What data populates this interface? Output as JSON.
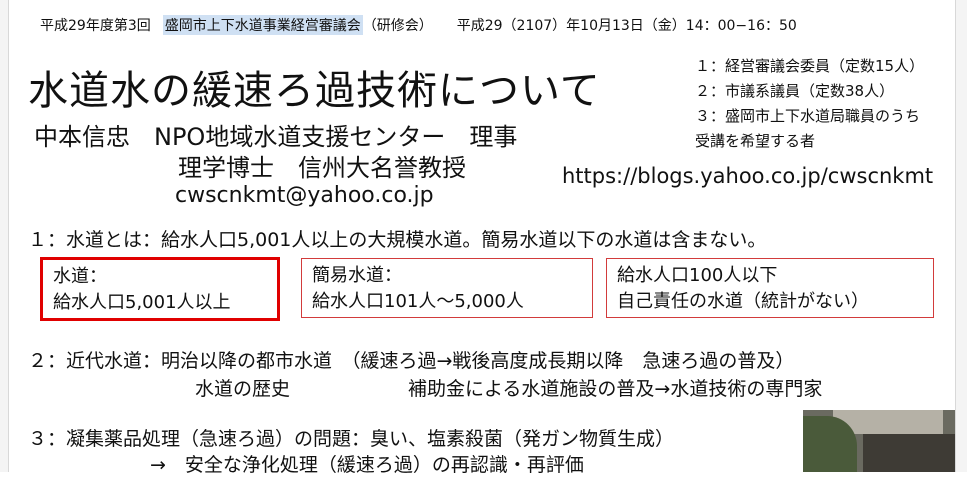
{
  "header": {
    "session": "平成29年度第3回",
    "org": "盛岡市上下水道事業経営審議会",
    "session_type": "（研修会）",
    "datetime": "平成29（2107）年10月13日（金）14：00−16：50"
  },
  "title": "水道水の緩速ろ過技術について",
  "speaker": {
    "name_line": "中本信忠　NPO地域水道支援センター　理事",
    "credentials": "理学博士　信州大名誉教授",
    "email": "cwscnkmt@yahoo.co.jp",
    "url": "https://blogs.yahoo.co.jp/cwscnkmt"
  },
  "audience": [
    "１：経営審議会委員（定数15人）",
    "２：市議系議員（定数38人）",
    "３：盛岡市上下水道局職員のうち",
    "受講を希望する者"
  ],
  "section1": {
    "text": "１：水道とは：給水人口5,001人以上の大規模水道。簡易水道以下の水道は含まない。",
    "boxes": [
      {
        "line1": "水道：",
        "line2": "給水人口5,001人以上"
      },
      {
        "line1": "簡易水道：",
        "line2": "給水人口101人〜5,000人"
      },
      {
        "line1": "給水人口100人以下",
        "line2": "自己責任の水道（統計がない）"
      }
    ]
  },
  "section2": {
    "line1": "２：近代水道：明治以降の都市水道　（緩速ろ過→戦後高度成長期以降　急速ろ過の普及）",
    "line2a": "水道の歴史",
    "line2b": "補助金による水道施設の普及→水道技術の専門家"
  },
  "section3": {
    "line1": "３：凝集薬品処理（急速ろ過）の問題：臭い、塩素殺菌（発ガン物質生成）",
    "line2": "→　安全な浄化処理（緩速ろ過）の再認識・再評価"
  }
}
